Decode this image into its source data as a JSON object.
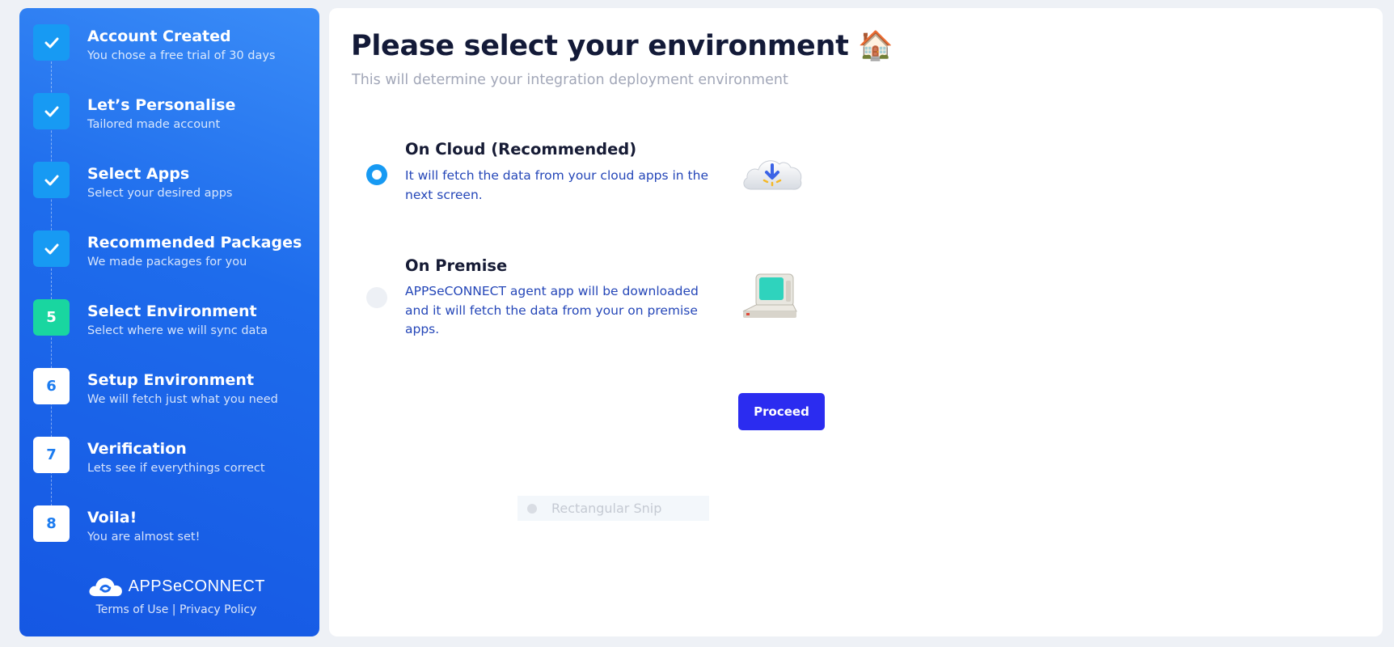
{
  "sidebar": {
    "steps": [
      {
        "badge": "✓",
        "title": "Account Created",
        "subtitle": "You chose a free trial of 30 days",
        "state": "done"
      },
      {
        "badge": "✓",
        "title": "Let’s Personalise",
        "subtitle": "Tailored made account",
        "state": "done"
      },
      {
        "badge": "✓",
        "title": "Select Apps",
        "subtitle": "Select your desired apps",
        "state": "done"
      },
      {
        "badge": "✓",
        "title": "Recommended Packages",
        "subtitle": "We made packages for you",
        "state": "done"
      },
      {
        "badge": "5",
        "title": "Select Environment",
        "subtitle": "Select where we will sync data",
        "state": "current"
      },
      {
        "badge": "6",
        "title": "Setup Environment",
        "subtitle": "We will fetch just what you need",
        "state": "todo"
      },
      {
        "badge": "7",
        "title": "Verification",
        "subtitle": "Lets see if everythings correct",
        "state": "todo"
      },
      {
        "badge": "8",
        "title": "Voila!",
        "subtitle": "You are almost set!",
        "state": "todo"
      }
    ],
    "brand": {
      "name": "APPSeCONNECT",
      "terms": "Terms of Use",
      "separator": " | ",
      "privacy": "Privacy Policy"
    }
  },
  "main": {
    "title": "Please select your environment 🏠",
    "subtitle": "This will determine your integration deployment environment",
    "options": [
      {
        "title": "On Cloud (Recommended)",
        "description": "It will fetch the data from your cloud apps in the next screen.",
        "selected": true,
        "icon": "cloud-download-icon"
      },
      {
        "title": "On Premise",
        "description": "APPSeCONNECT agent app will be downloaded and it will fetch the data from your on premise apps.",
        "selected": false,
        "icon": "desktop-computer-icon"
      }
    ],
    "proceed_label": "Proceed",
    "snip_label": "Rectangular Snip"
  },
  "colors": {
    "sidebar_gradient_start": "#3a8cf7",
    "sidebar_gradient_end": "#1557e3",
    "done_badge": "#179af3",
    "current_badge": "#19d6a0",
    "proceed_button": "#2b2cf0",
    "description_text": "#2446b8"
  }
}
